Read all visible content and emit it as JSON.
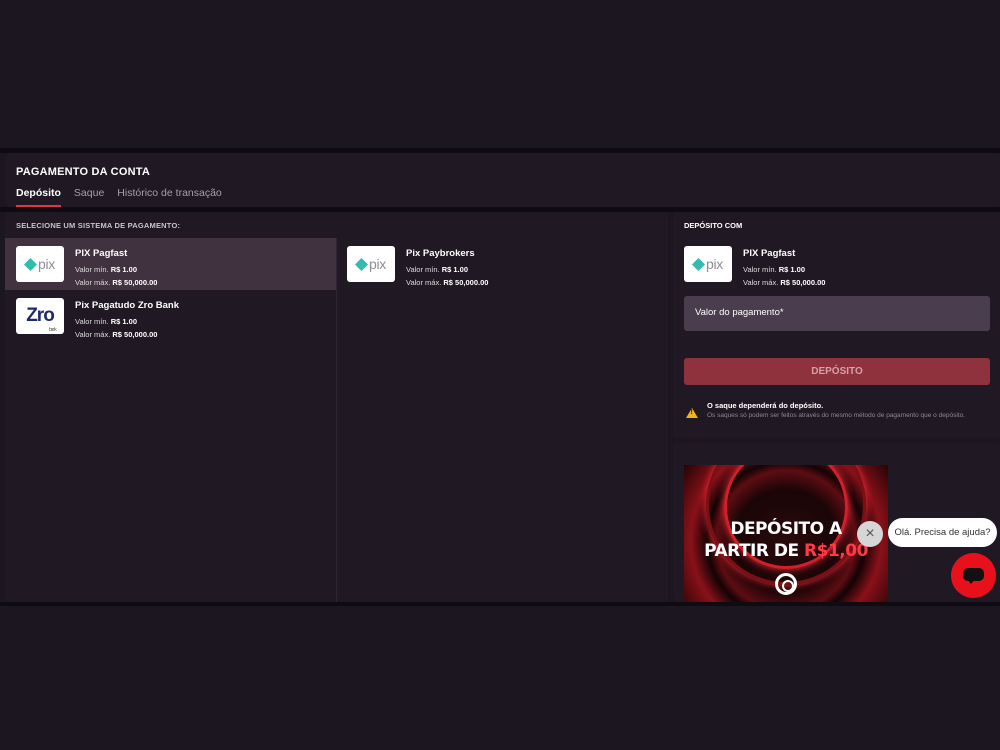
{
  "header": {
    "title": "PAGAMENTO DA CONTA",
    "tabs": [
      {
        "label": "Depósito",
        "active": true
      },
      {
        "label": "Saque",
        "active": false
      },
      {
        "label": "Histórico de transação",
        "active": false
      }
    ]
  },
  "payment_systems": {
    "label": "SELECIONE UM SISTEMA DE PAGAMENTO:",
    "items": [
      {
        "name": "PIX Pagfast",
        "logo": "pix-logo",
        "logo_text": "pix",
        "min_label": "Valor mín.",
        "min_value": "R$ 1.00",
        "max_label": "Valor máx.",
        "max_value": "R$ 50,000.00",
        "selected": true
      },
      {
        "name": "Pix Pagatudo Zro Bank",
        "logo": "zro-bank-logo",
        "logo_text": "Zro",
        "logo_sub": "bank",
        "min_label": "Valor mín.",
        "min_value": "R$ 1.00",
        "max_label": "Valor máx.",
        "max_value": "R$ 50,000.00",
        "selected": false
      },
      {
        "name": "Pix Paybrokers",
        "logo": "pix-logo",
        "logo_text": "pix",
        "min_label": "Valor mín.",
        "min_value": "R$ 1.00",
        "max_label": "Valor máx.",
        "max_value": "R$ 50,000.00",
        "selected": false
      }
    ]
  },
  "deposit": {
    "label": "DEPÓSITO COM",
    "method_name": "PIX Pagfast",
    "logo_text": "pix",
    "min_label": "Valor mín.",
    "min_value": "R$ 1.00",
    "max_label": "Valor máx.",
    "max_value": "R$ 50,000.00",
    "amount_placeholder": "Valor do pagamento*",
    "button_label": "DEPÓSITO",
    "warning_title": "O saque dependerá do depósito.",
    "warning_body": "Os saques só podem ser feitos através do mesmo método de pagamento que o depósito."
  },
  "banner": {
    "line1": "DEPÓSITO A",
    "line2_prefix": "PARTIR DE ",
    "line2_highlight": "R$1,00"
  },
  "chat": {
    "close_label": "×",
    "help_text": "Olá. Precisa de ajuda?"
  },
  "colors": {
    "accent": "#e0373f",
    "button": "#8e323d",
    "selected_row": "#40323f",
    "panel": "#201924",
    "background": "#1c1620",
    "warning": "#f2b31c",
    "chat": "#e8101a"
  }
}
